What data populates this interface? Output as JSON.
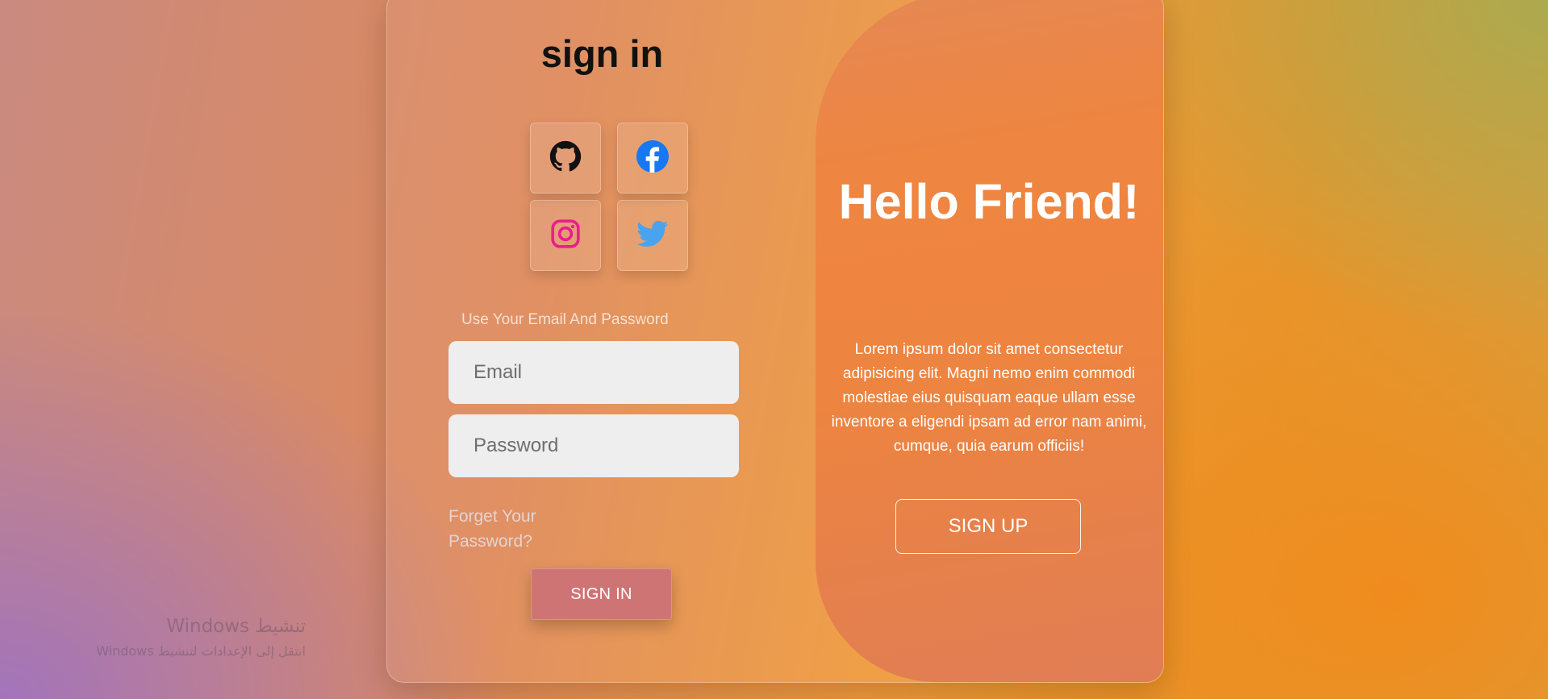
{
  "signin": {
    "title": "sign in",
    "social": [
      {
        "icon": "github-icon",
        "color": "#111111"
      },
      {
        "icon": "facebook-icon",
        "color": "#1877f2"
      },
      {
        "icon": "instagram-icon",
        "color": "#e91e8c"
      },
      {
        "icon": "twitter-icon",
        "color": "#4aa3ee"
      }
    ],
    "hint": "Use Your Email And Password",
    "email_placeholder": "Email",
    "password_placeholder": "Password",
    "forgot": "Forget Your Password?",
    "button": "SIGN IN"
  },
  "panel": {
    "heading": "Hello Friend!",
    "text": "Lorem ipsum dolor sit amet consectetur adipisicing elit. Magni nemo enim commodi molestiae eius quisquam eaque ullam esse inventore a eligendi ipsam ad error nam animi, cumque, quia earum officiis!",
    "button": "SIGN UP"
  },
  "watermark": {
    "line1": "تنشيط Windows",
    "line2": "انتقل إلى الإعدادات لتنشيط Windows"
  },
  "colors": {
    "signin_button": "#cf7475",
    "panel": "#ed8440",
    "input_bg": "#eeeeee"
  }
}
